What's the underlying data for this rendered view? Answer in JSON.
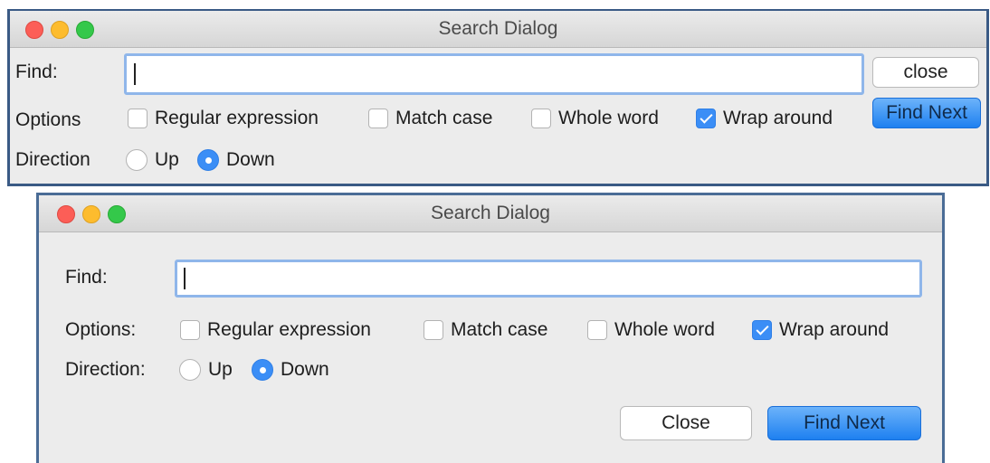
{
  "windows": [
    {
      "title": "Search Dialog",
      "find_label": "Find:",
      "find_value": "",
      "options_label": "Options",
      "direction_label": "Direction",
      "options": [
        {
          "label": "Regular expression",
          "checked": false
        },
        {
          "label": "Match case",
          "checked": false
        },
        {
          "label": "Whole word",
          "checked": false
        },
        {
          "label": "Wrap around",
          "checked": true
        }
      ],
      "directions": [
        {
          "label": "Up",
          "selected": false
        },
        {
          "label": "Down",
          "selected": true
        }
      ],
      "close_button": "close",
      "find_next_button": "Find Next"
    },
    {
      "title": "Search Dialog",
      "find_label": "Find:",
      "find_value": "",
      "options_label": "Options:",
      "direction_label": "Direction:",
      "options": [
        {
          "label": "Regular expression",
          "checked": false
        },
        {
          "label": "Match case",
          "checked": false
        },
        {
          "label": "Whole word",
          "checked": false
        },
        {
          "label": "Wrap around",
          "checked": true
        }
      ],
      "directions": [
        {
          "label": "Up",
          "selected": false
        },
        {
          "label": "Down",
          "selected": true
        }
      ],
      "close_button": "Close",
      "find_next_button": "Find Next"
    }
  ],
  "colors": {
    "accent": "#3b8ef6",
    "focus_ring": "#8fb6ea",
    "window_bg": "#ececec",
    "close_light": "#fc5e57",
    "minimize_light": "#fdbc2e",
    "zoom_light": "#34c84a"
  }
}
